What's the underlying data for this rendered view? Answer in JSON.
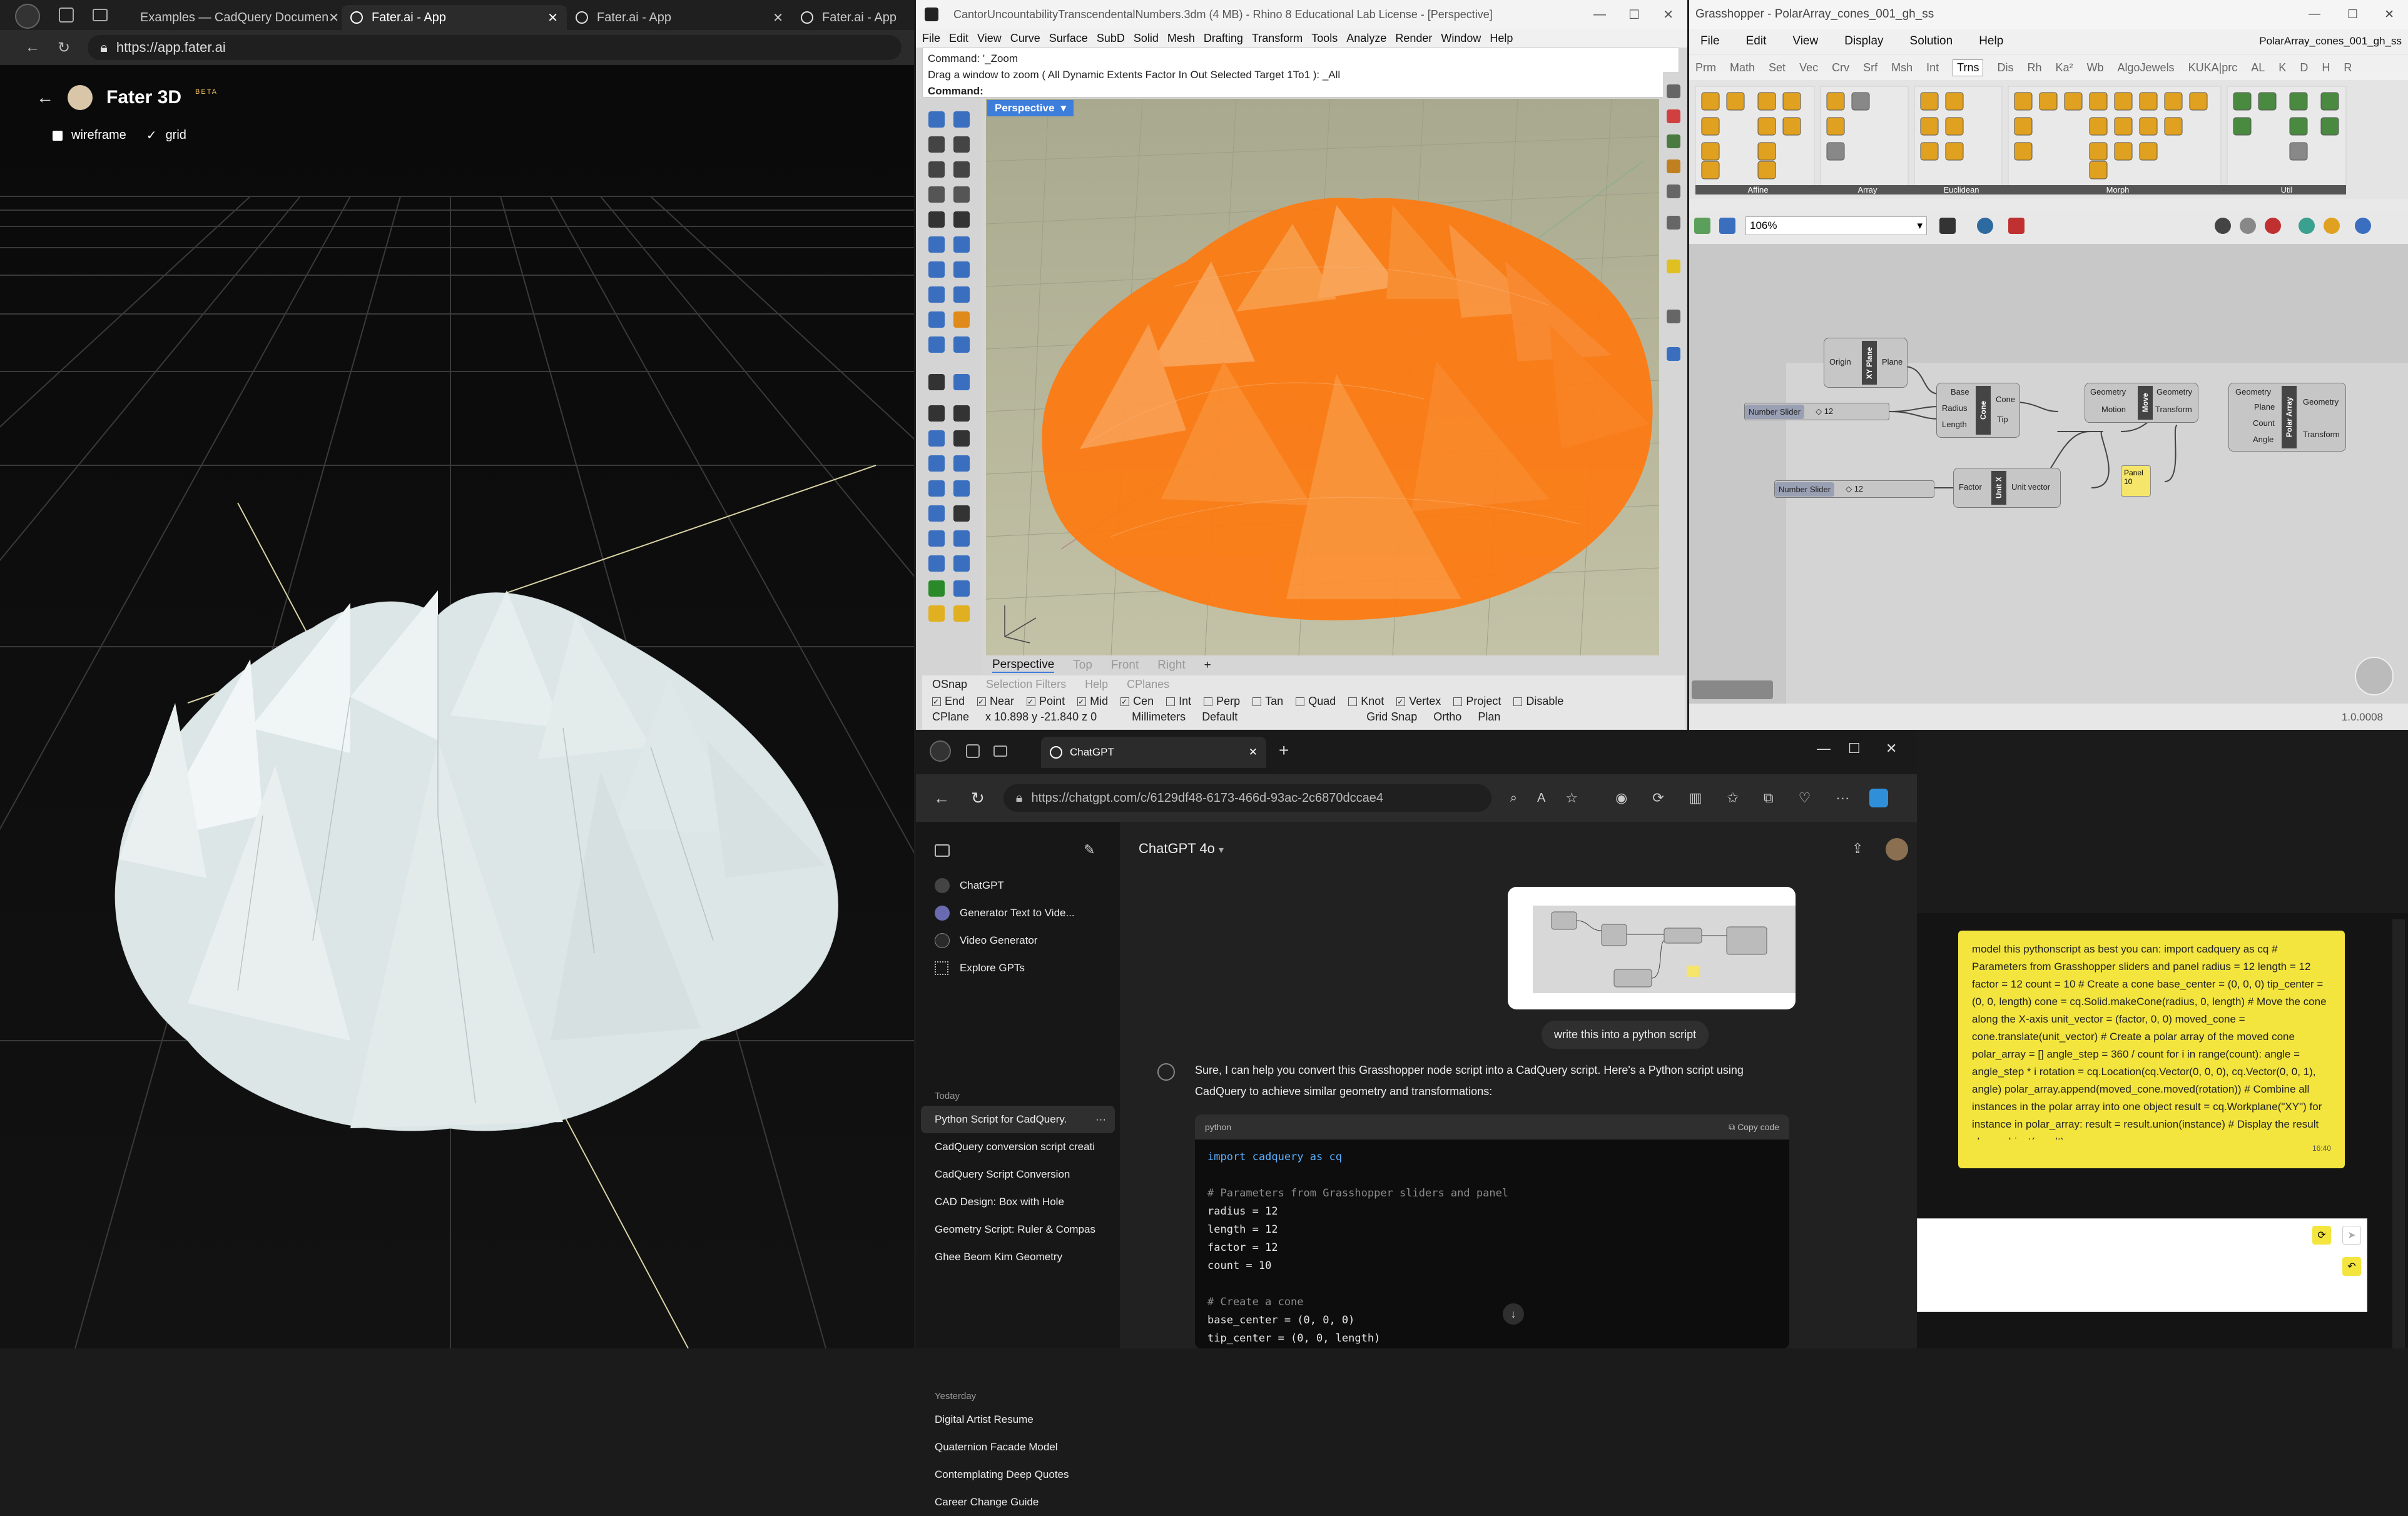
{
  "left_browser": {
    "tabs": [
      {
        "label": "Examples — CadQuery Documen"
      },
      {
        "label": "Fater.ai - App"
      },
      {
        "label": "Fater.ai - App"
      },
      {
        "label": "Fater.ai - App"
      }
    ],
    "url": "https://app.fater.ai",
    "app_name": "Fater 3D",
    "beta_badge": "BETA",
    "toggles": [
      {
        "label": "wireframe",
        "checked": false
      },
      {
        "label": "grid",
        "checked": true
      }
    ]
  },
  "rhino": {
    "title": "CantorUncountabilityTranscendentalNumbers.3dm (4 MB) - Rhino 8 Educational Lab License - [Perspective]",
    "menu": [
      "File",
      "Edit",
      "View",
      "Curve",
      "Surface",
      "SubD",
      "Solid",
      "Mesh",
      "Drafting",
      "Transform",
      "Tools",
      "Analyze",
      "Render",
      "Window",
      "Help"
    ],
    "command_history_1": "Command: '_Zoom",
    "command_history_2": "Drag a window to zoom ( All  Dynamic  Extents  Factor  In  Out  Selected  Target  1To1 ): _All",
    "command_prompt": "Command:",
    "viewport_label": "Perspective",
    "view_tabs": [
      "Perspective",
      "Top",
      "Front",
      "Right"
    ],
    "osnap_header": [
      "OSnap",
      "Selection Filters",
      "Help",
      "CPlanes"
    ],
    "osnaps": [
      {
        "label": "End",
        "checked": true
      },
      {
        "label": "Near",
        "checked": true
      },
      {
        "label": "Point",
        "checked": true
      },
      {
        "label": "Mid",
        "checked": true
      },
      {
        "label": "Cen",
        "checked": true
      },
      {
        "label": "Int",
        "checked": false
      },
      {
        "label": "Perp",
        "checked": false
      },
      {
        "label": "Tan",
        "checked": false
      },
      {
        "label": "Quad",
        "checked": false
      },
      {
        "label": "Knot",
        "checked": false
      },
      {
        "label": "Vertex",
        "checked": true
      },
      {
        "label": "Project",
        "checked": false
      },
      {
        "label": "Disable",
        "checked": false
      }
    ],
    "status": {
      "cplane": "CPlane",
      "coords": "x 10.898   y -21.840   z 0",
      "units": "Millimeters",
      "layer": "Default",
      "grid_snap": "Grid Snap",
      "ortho": "Ortho",
      "planar": "Plan"
    }
  },
  "grasshopper": {
    "title": "Grasshopper - PolarArray_cones_001_gh_ss",
    "doc_name": "PolarArray_cones_001_gh_ss",
    "menu": [
      "File",
      "Edit",
      "View",
      "Display",
      "Solution",
      "Help"
    ],
    "tabs": [
      "Prm",
      "Math",
      "Set",
      "Vec",
      "Crv",
      "Srf",
      "Msh",
      "Int",
      "Trns",
      "Dis",
      "Rh",
      "Ka²",
      "Wb",
      "AlgoJewels",
      "KUKA|prc",
      "AL",
      "K",
      "D",
      "H",
      "R"
    ],
    "active_tab": "Trns",
    "ribbon_groups": [
      "Affine",
      "Array",
      "Euclidean",
      "Morph",
      "Util"
    ],
    "zoom": "106%",
    "version": "1.0.0008",
    "nodes": {
      "xyplane": {
        "title": "XY Plane",
        "inputs": [
          "Origin"
        ],
        "outputs": [
          "Plane"
        ]
      },
      "cone": {
        "title": "Cone",
        "inputs": [
          "Base",
          "Radius",
          "Length"
        ],
        "outputs": [
          "Cone",
          "Tip"
        ]
      },
      "move": {
        "title": "Move",
        "inputs": [
          "Geometry",
          "Motion"
        ],
        "outputs": [
          "Geometry",
          "Transform"
        ]
      },
      "polararray": {
        "title": "Polar Array",
        "inputs": [
          "Geometry",
          "Plane",
          "Count",
          "Angle"
        ],
        "outputs": [
          "Geometry",
          "Transform"
        ]
      },
      "unitx": {
        "title": "Unit X",
        "inputs": [
          "Factor"
        ],
        "outputs": [
          "Unit vector"
        ]
      },
      "slider1": {
        "label": "Number Slider",
        "value": "◇ 12"
      },
      "slider2": {
        "label": "Number Slider",
        "value": "◇ 12"
      },
      "panel": {
        "label": "Panel",
        "value": "10"
      }
    }
  },
  "chatgpt": {
    "tab_label": "ChatGPT",
    "url": "https://chatgpt.com/c/6129df48-6173-466d-93ac-2c6870dccae4",
    "model": "ChatGPT 4o",
    "sidebar_top": [
      "ChatGPT",
      "Generator Text to Vide...",
      "Video Generator",
      "Explore GPTs"
    ],
    "section_today": "Today",
    "today": [
      "Python Script for CadQuery.",
      "CadQuery conversion script creati",
      "CadQuery Script Conversion",
      "CAD Design: Box with Hole",
      "Geometry Script: Ruler & Compas",
      "Ghee Beom Kim Geometry"
    ],
    "section_yesterday": "Yesterday",
    "yesterday": [
      "Digital Artist Resume",
      "Quaternion Facade Model",
      "Contemplating Deep Quotes",
      "Career Change Guide"
    ],
    "user_message": "write this into a python script",
    "assistant_intro": "Sure, I can help you convert this Grasshopper node script into a CadQuery script. Here's a Python script using CadQuery to achieve similar geometry and transformations:",
    "code_lang": "python",
    "copy_label": "Copy code",
    "code_lines": [
      "import cadquery as cq",
      "",
      "# Parameters from Grasshopper sliders and panel",
      "radius = 12",
      "length = 12",
      "factor = 12",
      "count = 10",
      "",
      "# Create a cone",
      "base_center = (0, 0, 0)",
      "tip_center = (0, 0, length)"
    ]
  },
  "note": {
    "text": "model this pythonscript as best you can: import cadquery as cq # Parameters from Grasshopper sliders and panel radius = 12 length = 12 factor = 12 count = 10 # Create a cone base_center = (0, 0, 0) tip_center = (0, 0, length) cone = cq.Solid.makeCone(radius, 0, length) # Move the cone along the X-axis unit_vector = (factor, 0, 0) moved_cone = cone.translate(unit_vector) # Create a polar array of the moved cone polar_array = [] angle_step = 360 / count for i in range(count): angle = angle_step * i rotation = cq.Location(cq.Vector(0, 0, 0), cq.Vector(0, 0, 1), angle) polar_array.append(moved_cone.moved(rotation)) # Combine all instances in the polar array into one object result = cq.Workplane(\"XY\") for instance in polar_array: result = result.union(instance) # Display the result show_object(result)",
    "time": "16:40"
  },
  "colors": {
    "rhino_orange": "#ff7a10",
    "rhino_active_tab": "#3d7ddb",
    "note_yellow": "#f3e53e",
    "fater_mesh": "#dfe8e8"
  }
}
